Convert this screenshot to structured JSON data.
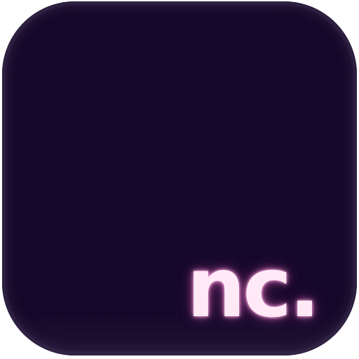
{
  "icon": {
    "logo_text": "nc.",
    "background_color": "#16082a",
    "text_color": "#ffe9f6",
    "glow_color": "#ff82d2"
  }
}
